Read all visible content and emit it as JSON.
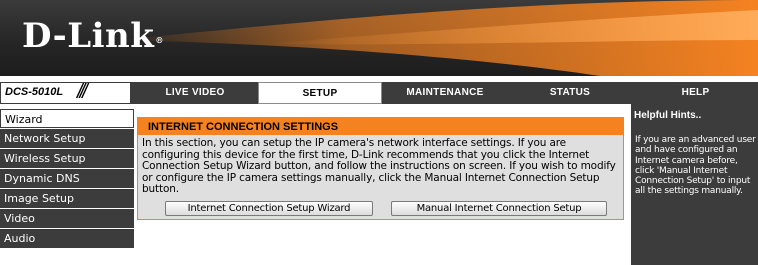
{
  "brand": {
    "logo_text": "D-Link",
    "logo_mark": "®",
    "model": "DCS-5010L",
    "model_decor": "///"
  },
  "nav": {
    "tabs": [
      {
        "label": "LIVE VIDEO"
      },
      {
        "label": "SETUP",
        "active": true
      },
      {
        "label": "MAINTENANCE"
      },
      {
        "label": "STATUS"
      },
      {
        "label": "HELP"
      }
    ]
  },
  "sidebar": {
    "items": [
      {
        "label": "Wizard",
        "active": true
      },
      {
        "label": "Network Setup"
      },
      {
        "label": "Wireless Setup"
      },
      {
        "label": "Dynamic DNS"
      },
      {
        "label": "Image Setup"
      },
      {
        "label": "Video"
      },
      {
        "label": "Audio"
      }
    ]
  },
  "main": {
    "title": "INTERNET CONNECTION SETTINGS",
    "description": "In this section, you can setup the IP camera's network interface settings. If you are configuring this device for the first time, D-Link recommends that you click the Internet Connection Setup Wizard button, and follow the instructions on screen. If you wish to modify or configure the IP camera settings manually, click the Manual Internet Connection Setup button.",
    "wizard_button": "Internet Connection Setup Wizard",
    "manual_button": "Manual Internet Connection Setup"
  },
  "hints": {
    "title": "Helpful Hints..",
    "text": "If you are an advanced user and have configured an Internet camera before, click 'Manual Internet Connection Setup' to input all the settings manually."
  },
  "colors": {
    "accent": "#f48221",
    "dark": "#3c3c3c",
    "panel": "#dfdfdf"
  }
}
